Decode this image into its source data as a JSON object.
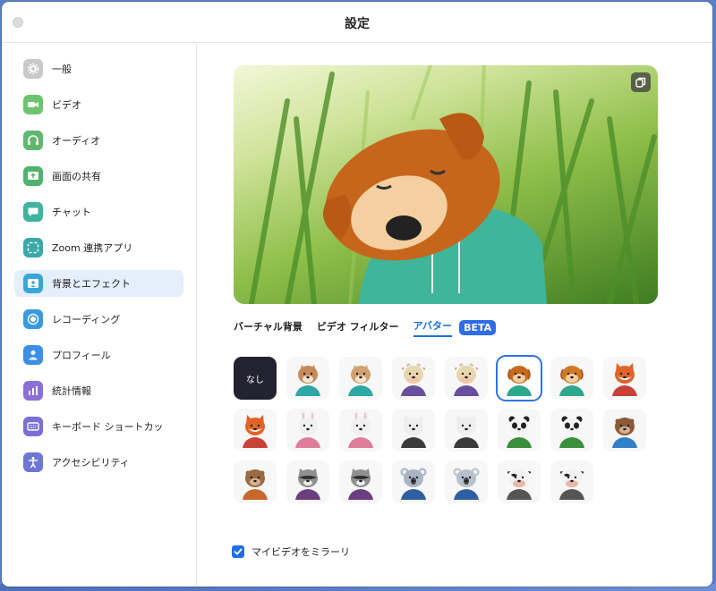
{
  "window": {
    "title": "設定"
  },
  "sidebar": {
    "items": [
      {
        "label": "一般",
        "icon": "gear-icon",
        "color": "#c9c9c9"
      },
      {
        "label": "ビデオ",
        "icon": "video-camera-icon",
        "color": "#6dc46d"
      },
      {
        "label": "オーディオ",
        "icon": "headphones-icon",
        "color": "#5fb86f"
      },
      {
        "label": "画面の共有",
        "icon": "share-screen-icon",
        "color": "#4fb36b"
      },
      {
        "label": "チャット",
        "icon": "chat-bubble-icon",
        "color": "#3fb3a0"
      },
      {
        "label": "Zoom 連携アプリ",
        "icon": "apps-icon",
        "color": "#3aa9a8"
      },
      {
        "label": "背景とエフェクト",
        "icon": "background-icon",
        "color": "#3aa6d8",
        "active": true
      },
      {
        "label": "レコーディング",
        "icon": "record-icon",
        "color": "#3a9ae0"
      },
      {
        "label": "プロフィール",
        "icon": "person-icon",
        "color": "#3d8fe3"
      },
      {
        "label": "統計情報",
        "icon": "stats-icon",
        "color": "#8b6fd6"
      },
      {
        "label": "キーボード ショートカッ",
        "icon": "keyboard-icon",
        "color": "#7a6fd6"
      },
      {
        "label": "アクセシビリティ",
        "icon": "accessibility-icon",
        "color": "#6e76d6"
      }
    ]
  },
  "main": {
    "preview": {
      "copy_icon": "copy-icon"
    },
    "tabs": [
      {
        "label": "バーチャル背景"
      },
      {
        "label": "ビデオ フィルター"
      },
      {
        "label": "アバター",
        "active": true
      }
    ],
    "beta_badge": "BETA",
    "avatars": {
      "none_label": "なし",
      "items": [
        {
          "animal": "cat",
          "face": "#c98a5a",
          "shirt": "#2fa7a4"
        },
        {
          "animal": "cat",
          "face": "#d3a070",
          "shirt": "#2fa7a4"
        },
        {
          "animal": "cow",
          "face": "#e8d6b0",
          "shirt": "#6a4fa0"
        },
        {
          "animal": "cow",
          "face": "#e8d6b0",
          "shirt": "#6a4fa0"
        },
        {
          "animal": "dog",
          "face": "#c76a1e",
          "shirt": "#2fa78c",
          "selected": true
        },
        {
          "animal": "dog",
          "face": "#d07a28",
          "shirt": "#2fa78c"
        },
        {
          "animal": "fox",
          "face": "#e0642a",
          "shirt": "#c8423a"
        },
        {
          "animal": "fox",
          "face": "#e0642a",
          "shirt": "#c8423a"
        },
        {
          "animal": "rabbit",
          "face": "#f0f0f0",
          "shirt": "#e07c9c"
        },
        {
          "animal": "rabbit",
          "face": "#f0f0f0",
          "shirt": "#e07c9c"
        },
        {
          "animal": "bear",
          "face": "#eeeeee",
          "shirt": "#3a3a3a"
        },
        {
          "animal": "bear",
          "face": "#eeeeee",
          "shirt": "#3a3a3a"
        },
        {
          "animal": "panda",
          "face": "#f4f4f4",
          "shirt": "#3a8f3a"
        },
        {
          "animal": "panda",
          "face": "#f4f4f4",
          "shirt": "#3a8f3a"
        },
        {
          "animal": "otter",
          "face": "#8a5a3a",
          "shirt": "#2f7fc9"
        },
        {
          "animal": "otter",
          "face": "#9a6a42",
          "shirt": "#c8682a"
        },
        {
          "animal": "raccoon",
          "face": "#8f8f8f",
          "shirt": "#6a3f80"
        },
        {
          "animal": "raccoon",
          "face": "#8f8f8f",
          "shirt": "#6a3f80"
        },
        {
          "animal": "koala",
          "face": "#a8b4c4",
          "shirt": "#2f5fa0"
        },
        {
          "animal": "koala",
          "face": "#b8c0cc",
          "shirt": "#2f5fa0"
        },
        {
          "animal": "cow-bw",
          "face": "#f2f2f2",
          "shirt": "#555555"
        },
        {
          "animal": "cow-bw",
          "face": "#f2f2f2",
          "shirt": "#555555"
        }
      ]
    },
    "mirror": {
      "label": "マイビデオをミラーリ",
      "checked": true
    }
  },
  "colors": {
    "accent": "#1a6fe0",
    "beta": "#2f6de6"
  }
}
